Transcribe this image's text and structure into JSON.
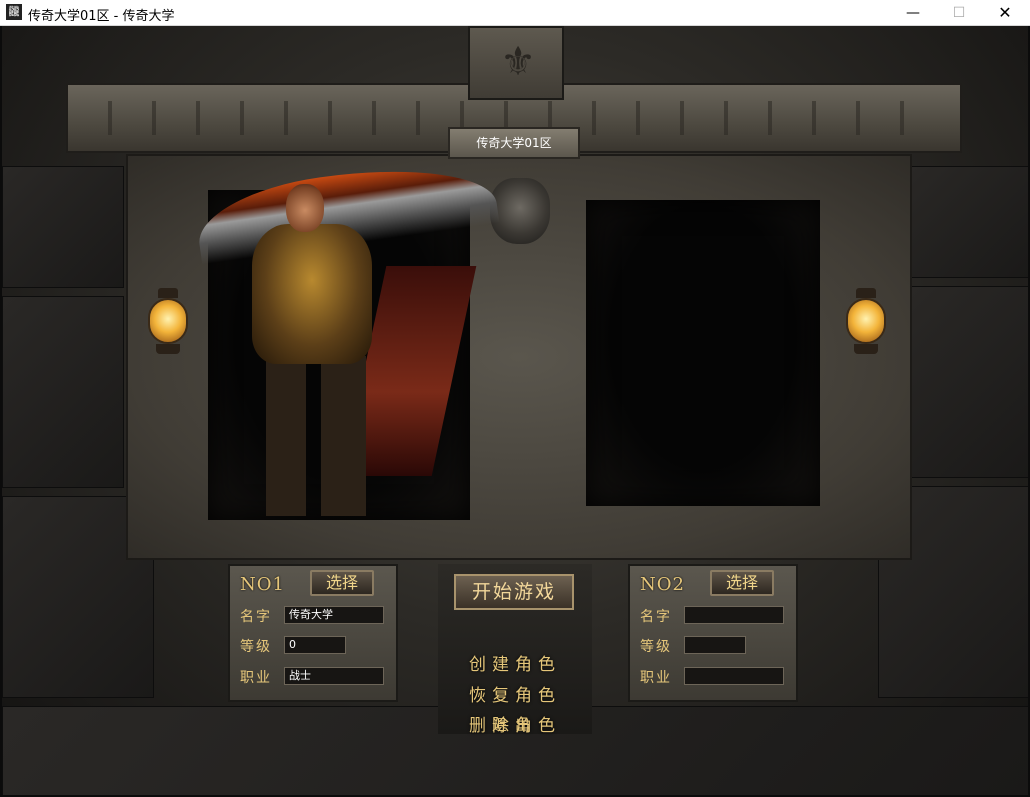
{
  "window": {
    "title": "传奇大学01区 - 传奇大学",
    "app_icon": "龖",
    "minimize": "—",
    "maximize": "☐",
    "close": "✕"
  },
  "server_name": "传奇大学01区",
  "slot1": {
    "no_label": "NO1",
    "select_label": "选择",
    "name_label": "名字",
    "name_value": "传奇大学",
    "level_label": "等级",
    "level_value": "0",
    "class_label": "职业",
    "class_value": "战士"
  },
  "slot2": {
    "no_label": "NO2",
    "select_label": "选择",
    "name_label": "名字",
    "name_value": "",
    "level_label": "等级",
    "level_value": "",
    "class_label": "职业",
    "class_value": ""
  },
  "menu": {
    "start_game": "开始游戏",
    "create_role": "创建角色",
    "restore_role": "恢复角色",
    "delete_role": "删除角色",
    "exit": "退出"
  },
  "icons": {
    "keystone": "⚜"
  }
}
